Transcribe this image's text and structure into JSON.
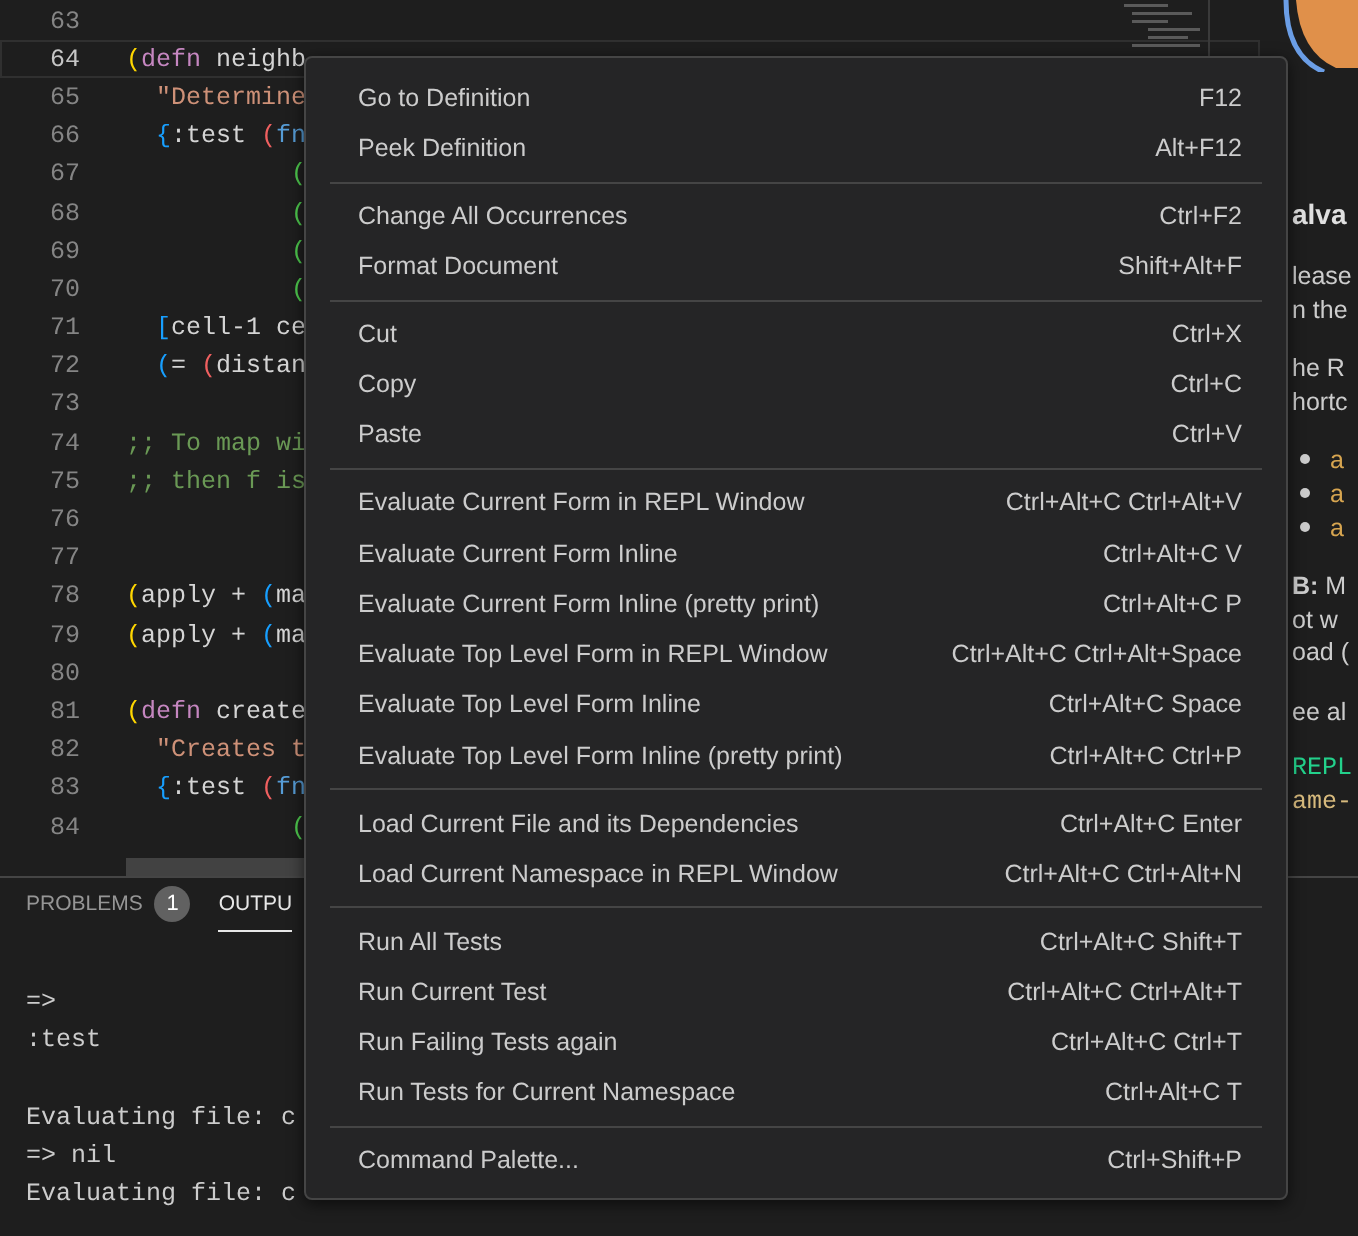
{
  "editor": {
    "lines": [
      {
        "number": "63",
        "current": false
      },
      {
        "number": "64",
        "current": true,
        "tokens": [
          {
            "text": "(",
            "kind": "bracket1"
          },
          {
            "text": "defn",
            "kind": "keyword"
          },
          {
            "text": " neighb",
            "kind": "text"
          }
        ]
      },
      {
        "number": "65",
        "current": false,
        "tokens": [
          {
            "text": "  \"Determine",
            "kind": "string"
          }
        ]
      },
      {
        "number": "66",
        "current": false,
        "tokens": [
          {
            "text": "  {",
            "kind": "bracket2"
          },
          {
            "text": ":test ",
            "kind": "text"
          },
          {
            "text": "(",
            "kind": "bracket3"
          },
          {
            "text": "fn",
            "kind": "function"
          }
        ]
      },
      {
        "number": "67",
        "current": false,
        "tokens": [
          {
            "text": "           (",
            "kind": "bracket4"
          }
        ]
      },
      {
        "number": "68",
        "current": false,
        "tokens": [
          {
            "text": "           (",
            "kind": "bracket4"
          }
        ]
      },
      {
        "number": "69",
        "current": false,
        "tokens": [
          {
            "text": "           (",
            "kind": "bracket4"
          }
        ]
      },
      {
        "number": "70",
        "current": false,
        "tokens": [
          {
            "text": "           (",
            "kind": "bracket4"
          }
        ]
      },
      {
        "number": "71",
        "current": false,
        "tokens": [
          {
            "text": "  [",
            "kind": "bracket2"
          },
          {
            "text": "cell-1 ce",
            "kind": "text"
          }
        ]
      },
      {
        "number": "72",
        "current": false,
        "tokens": [
          {
            "text": "  (",
            "kind": "bracket2"
          },
          {
            "text": "= ",
            "kind": "text"
          },
          {
            "text": "(",
            "kind": "bracket3"
          },
          {
            "text": "distan",
            "kind": "text"
          }
        ]
      },
      {
        "number": "73",
        "current": false
      },
      {
        "number": "74",
        "current": false,
        "tokens": [
          {
            "text": ";; To map wi",
            "kind": "comment"
          }
        ]
      },
      {
        "number": "75",
        "current": false,
        "tokens": [
          {
            "text": ";; then f is",
            "kind": "comment"
          }
        ]
      },
      {
        "number": "76",
        "current": false
      },
      {
        "number": "77",
        "current": false
      },
      {
        "number": "78",
        "current": false,
        "tokens": [
          {
            "text": "(",
            "kind": "bracket1"
          },
          {
            "text": "apply + ",
            "kind": "text"
          },
          {
            "text": "(",
            "kind": "bracket2"
          },
          {
            "text": "ma",
            "kind": "text"
          }
        ]
      },
      {
        "number": "79",
        "current": false,
        "tokens": [
          {
            "text": "(",
            "kind": "bracket1"
          },
          {
            "text": "apply + ",
            "kind": "text"
          },
          {
            "text": "(",
            "kind": "bracket2"
          },
          {
            "text": "ma",
            "kind": "text"
          }
        ]
      },
      {
        "number": "80",
        "current": false
      },
      {
        "number": "81",
        "current": false,
        "tokens": [
          {
            "text": "(",
            "kind": "bracket1"
          },
          {
            "text": "defn",
            "kind": "keyword"
          },
          {
            "text": " create",
            "kind": "text"
          }
        ]
      },
      {
        "number": "82",
        "current": false,
        "tokens": [
          {
            "text": "  \"Creates t",
            "kind": "string"
          }
        ]
      },
      {
        "number": "83",
        "current": false,
        "tokens": [
          {
            "text": "  {",
            "kind": "bracket2"
          },
          {
            "text": ":test ",
            "kind": "text"
          },
          {
            "text": "(",
            "kind": "bracket3"
          },
          {
            "text": "fn",
            "kind": "function"
          }
        ]
      },
      {
        "number": "84",
        "current": false,
        "tokens": [
          {
            "text": "           (",
            "kind": "bracket4"
          }
        ]
      }
    ]
  },
  "preview": {
    "heading": "alva",
    "blocks": [
      {
        "kind": "paragraph",
        "lines": [
          "lease",
          "n the"
        ]
      },
      {
        "kind": "paragraph",
        "lines": [
          "he R",
          "hortc"
        ]
      },
      {
        "kind": "bullets",
        "items": [
          "a",
          "a",
          "a"
        ]
      },
      {
        "kind": "paragraph",
        "lines": [
          "**B:** M",
          "ot w",
          "oad ("
        ]
      },
      {
        "kind": "paragraph",
        "lines": [
          "ee al"
        ]
      },
      {
        "kind": "code",
        "lines": [
          {
            "text": "REPL",
            "color": "#23d18b"
          },
          {
            "text": "ame-",
            "color": "#d7ba7d"
          }
        ]
      }
    ]
  },
  "panel": {
    "tabs": [
      {
        "label": "PROBLEMS",
        "badge": "1",
        "selected": false
      },
      {
        "label": "OUTPU",
        "selected": true
      }
    ],
    "output": [
      [
        "=>",
        ":test"
      ],
      [
        "Evaluating file: c",
        "=> nil",
        "Evaluating file: c"
      ]
    ]
  },
  "context_menu": {
    "groups": [
      [
        {
          "label": "Go to Definition",
          "shortcut": "F12"
        },
        {
          "label": "Peek Definition",
          "shortcut": "Alt+F12"
        }
      ],
      [
        {
          "label": "Change All Occurrences",
          "shortcut": "Ctrl+F2"
        },
        {
          "label": "Format Document",
          "shortcut": "Shift+Alt+F"
        }
      ],
      [
        {
          "label": "Cut",
          "shortcut": "Ctrl+X"
        },
        {
          "label": "Copy",
          "shortcut": "Ctrl+C"
        },
        {
          "label": "Paste",
          "shortcut": "Ctrl+V"
        }
      ],
      [
        {
          "label": "Evaluate Current Form in REPL Window",
          "shortcut": "Ctrl+Alt+C Ctrl+Alt+V"
        },
        {
          "label": "Evaluate Current Form Inline",
          "shortcut": "Ctrl+Alt+C V"
        },
        {
          "label": "Evaluate Current Form Inline (pretty print)",
          "shortcut": "Ctrl+Alt+C P"
        },
        {
          "label": "Evaluate Top Level Form in REPL Window",
          "shortcut": "Ctrl+Alt+C Ctrl+Alt+Space"
        },
        {
          "label": "Evaluate Top Level Form Inline",
          "shortcut": "Ctrl+Alt+C Space"
        },
        {
          "label": "Evaluate Top Level Form Inline (pretty print)",
          "shortcut": "Ctrl+Alt+C Ctrl+P"
        }
      ],
      [
        {
          "label": "Load Current File and its Dependencies",
          "shortcut": "Ctrl+Alt+C Enter"
        },
        {
          "label": "Load Current Namespace in REPL Window",
          "shortcut": "Ctrl+Alt+C Ctrl+Alt+N"
        }
      ],
      [
        {
          "label": "Run All Tests",
          "shortcut": "Ctrl+Alt+C Shift+T"
        },
        {
          "label": "Run Current Test",
          "shortcut": "Ctrl+Alt+C Ctrl+Alt+T"
        },
        {
          "label": "Run Failing Tests again",
          "shortcut": "Ctrl+Alt+C Ctrl+T"
        },
        {
          "label": "Run Tests for Current Namespace",
          "shortcut": "Ctrl+Alt+C T"
        }
      ],
      [
        {
          "label": "Command Palette...",
          "shortcut": "Ctrl+Shift+P"
        }
      ]
    ]
  }
}
